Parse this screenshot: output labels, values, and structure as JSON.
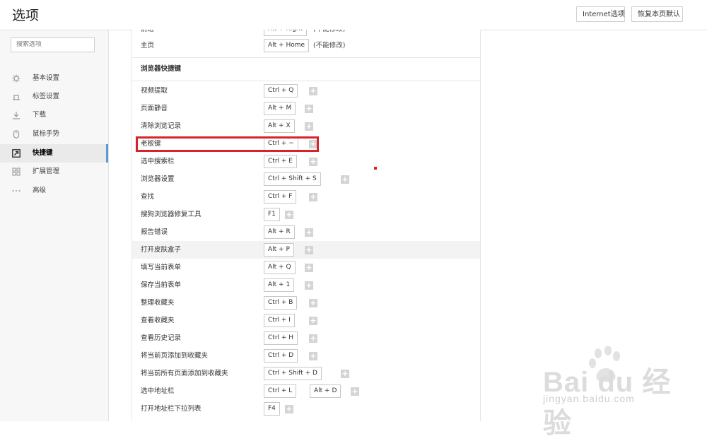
{
  "header": {
    "title": "选项",
    "btn_internet": "Internet选项",
    "btn_restore": "恢复本页默认"
  },
  "sidebar": {
    "search_placeholder": "搜索选项",
    "items": [
      {
        "label": "基本设置",
        "icon": "gear-icon"
      },
      {
        "label": "标签设置",
        "icon": "tab-icon"
      },
      {
        "label": "下载",
        "icon": "download-icon"
      },
      {
        "label": "鼠标手势",
        "icon": "mouse-icon"
      },
      {
        "label": "快捷键",
        "icon": "shortcut-icon",
        "active": true
      },
      {
        "label": "扩展管理",
        "icon": "extension-icon"
      },
      {
        "label": "高级",
        "icon": "more-icon"
      }
    ]
  },
  "top_rows": [
    {
      "name": "前进",
      "keys": [
        "Alt + Right"
      ],
      "note": "(不能修改)"
    },
    {
      "name": "主页",
      "keys": [
        "Alt + Home"
      ],
      "note": "(不能修改)"
    }
  ],
  "section_title": "浏览器快捷键",
  "shortcuts": [
    {
      "name": "视频提取",
      "keys": [
        "Ctrl + Q"
      ]
    },
    {
      "name": "页面静音",
      "keys": [
        "Alt + M"
      ]
    },
    {
      "name": "清除浏览记录",
      "keys": [
        "Alt + X"
      ]
    },
    {
      "name": "老板键",
      "keys": [
        "Ctrl + ~"
      ]
    },
    {
      "name": "选中搜索栏",
      "keys": [
        "Ctrl + E"
      ]
    },
    {
      "name": "浏览器设置",
      "keys": [
        "Ctrl + Shift + S"
      ]
    },
    {
      "name": "查找",
      "keys": [
        "Ctrl + F"
      ]
    },
    {
      "name": "搜狗浏览器修复工具",
      "keys": [
        "F1"
      ]
    },
    {
      "name": "报告错误",
      "keys": [
        "Alt + R"
      ]
    },
    {
      "name": "打开皮肤盒子",
      "keys": [
        "Alt + P"
      ]
    },
    {
      "name": "填写当前表单",
      "keys": [
        "Alt + Q"
      ]
    },
    {
      "name": "保存当前表单",
      "keys": [
        "Alt + 1"
      ]
    },
    {
      "name": "整理收藏夹",
      "keys": [
        "Ctrl + B"
      ]
    },
    {
      "name": "查看收藏夹",
      "keys": [
        "Ctrl + I"
      ]
    },
    {
      "name": "查看历史记录",
      "keys": [
        "Ctrl + H"
      ]
    },
    {
      "name": "将当前页添加到收藏夹",
      "keys": [
        "Ctrl + D"
      ]
    },
    {
      "name": "将当前所有页面添加到收藏夹",
      "keys": [
        "Ctrl + Shift + D"
      ]
    },
    {
      "name": "选中地址栏",
      "keys": [
        "Ctrl + L",
        "Alt + D"
      ]
    },
    {
      "name": "打开地址栏下拉列表",
      "keys": [
        "F4"
      ]
    }
  ],
  "add_symbol": "+",
  "watermark": {
    "text": "Bai du 经验",
    "url_text": "jingyan.baidu.com"
  },
  "colors": {
    "accent": "#5b9bd5",
    "highlight_box": "#d8232a"
  }
}
